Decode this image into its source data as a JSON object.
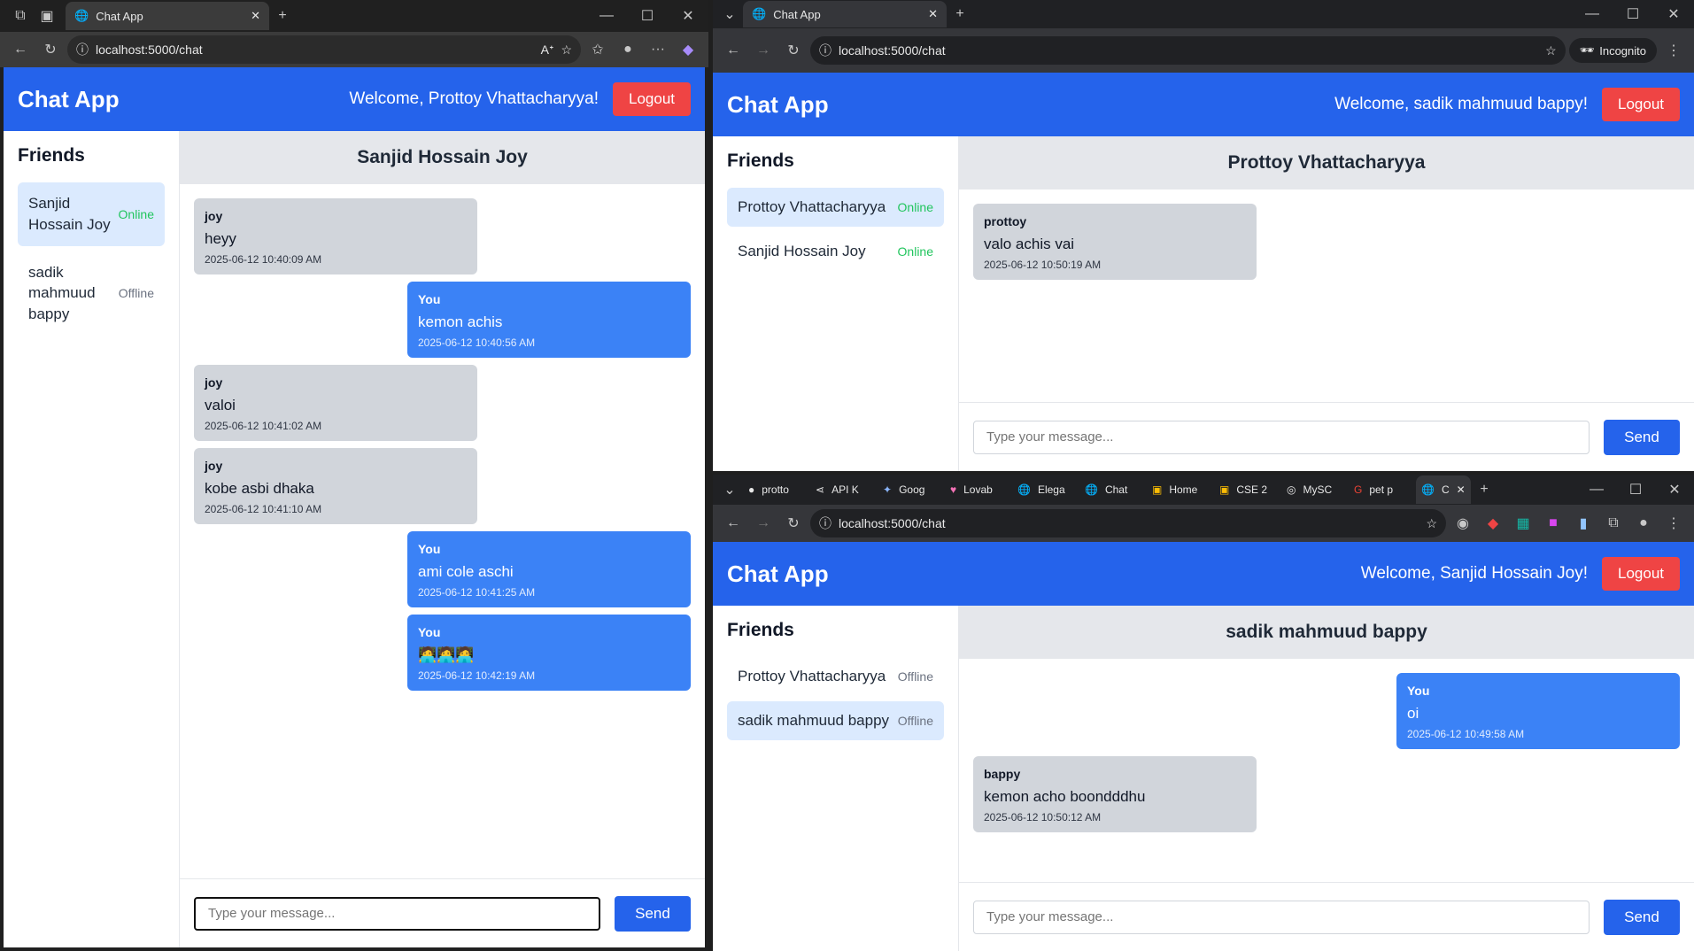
{
  "left_window": {
    "tab_title": "Chat App",
    "url": "localhost:5000/chat",
    "app": {
      "brand": "Chat App",
      "welcome": "Welcome, Prottoy Vhattacharyya!",
      "logout": "Logout",
      "friends_title": "Friends",
      "friends": [
        {
          "name": "Sanjid Hossain Joy",
          "status": "Online"
        },
        {
          "name": "sadik mahmuud bappy",
          "status": "Offline"
        }
      ],
      "chat_title": "Sanjid Hossain Joy",
      "messages": [
        {
          "sender": "joy",
          "text": "heyy",
          "time": "2025-06-12 10:40:09 AM"
        },
        {
          "sender": "You",
          "text": "kemon achis",
          "time": "2025-06-12 10:40:56 AM"
        },
        {
          "sender": "joy",
          "text": "valoi",
          "time": "2025-06-12 10:41:02 AM"
        },
        {
          "sender": "joy",
          "text": "kobe asbi dhaka",
          "time": "2025-06-12 10:41:10 AM"
        },
        {
          "sender": "You",
          "text": "ami cole aschi",
          "time": "2025-06-12 10:41:25 AM"
        },
        {
          "sender": "You",
          "text": "🧑‍💻🧑‍💻🧑‍💻",
          "time": "2025-06-12 10:42:19 AM"
        }
      ],
      "input_placeholder": "Type your message...",
      "send": "Send"
    }
  },
  "top_right_window": {
    "tab_title": "Chat App",
    "url": "localhost:5000/chat",
    "incognito_label": "Incognito",
    "app": {
      "brand": "Chat App",
      "welcome": "Welcome, sadik mahmuud bappy!",
      "logout": "Logout",
      "friends_title": "Friends",
      "friends": [
        {
          "name": "Prottoy Vhattacharyya",
          "status": "Online"
        },
        {
          "name": "Sanjid Hossain Joy",
          "status": "Online"
        }
      ],
      "chat_title": "Prottoy Vhattacharyya",
      "messages": [
        {
          "sender": "prottoy",
          "text": "valo achis vai",
          "time": "2025-06-12 10:50:19 AM"
        }
      ],
      "input_placeholder": "Type your message...",
      "send": "Send"
    }
  },
  "bottom_right_window": {
    "tabs": [
      "protto",
      "API K",
      "Goog",
      "Lovab",
      "Elega",
      "Chat",
      "Home",
      "CSE 2",
      "MySC",
      "pet p",
      "C"
    ],
    "url": "localhost:5000/chat",
    "app": {
      "brand": "Chat App",
      "welcome": "Welcome, Sanjid Hossain Joy!",
      "logout": "Logout",
      "friends_title": "Friends",
      "friends": [
        {
          "name": "Prottoy Vhattacharyya",
          "status": "Offline"
        },
        {
          "name": "sadik mahmuud bappy",
          "status": "Offline"
        }
      ],
      "chat_title": "sadik mahmuud bappy",
      "messages": [
        {
          "sender": "You",
          "text": "oi",
          "time": "2025-06-12 10:49:58 AM"
        },
        {
          "sender": "bappy",
          "text": "kemon acho boondddhu",
          "time": "2025-06-12 10:50:12 AM"
        }
      ],
      "input_placeholder": "Type your message...",
      "send": "Send"
    }
  },
  "colors": {
    "header": "#2563eb",
    "logout": "#ef4444",
    "online": "#22c55e",
    "outgoing": "#3b82f6",
    "incoming": "#d1d5db"
  }
}
